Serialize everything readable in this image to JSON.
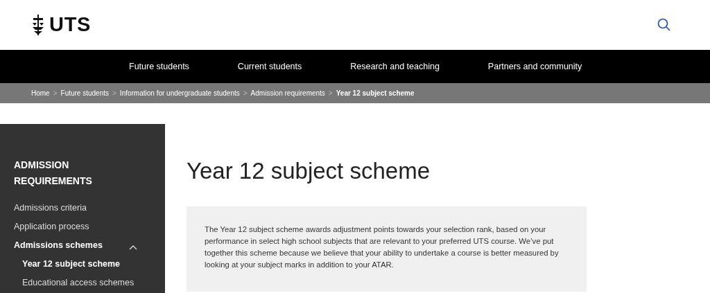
{
  "header": {
    "logo_text": "UTS"
  },
  "nav": [
    {
      "label": "Future students"
    },
    {
      "label": "Current students"
    },
    {
      "label": "Research and teaching"
    },
    {
      "label": "Partners and community"
    }
  ],
  "breadcrumb": [
    {
      "label": "Home",
      "current": false
    },
    {
      "label": "Future students",
      "current": false
    },
    {
      "label": "Information for undergraduate students",
      "current": false
    },
    {
      "label": "Admission requirements",
      "current": false
    },
    {
      "label": "Year 12 subject scheme",
      "current": true
    }
  ],
  "breadcrumb_separator": ">",
  "sidebar": {
    "title": "ADMISSION REQUIREMENTS",
    "items": [
      {
        "label": "Admissions criteria",
        "selected": false
      },
      {
        "label": "Application process",
        "selected": false
      },
      {
        "label": "Admissions schemes",
        "selected": true,
        "expanded": true,
        "children": [
          {
            "label": "Year 12 subject scheme",
            "selected": true
          },
          {
            "label": "Educational access schemes",
            "selected": false
          }
        ]
      }
    ]
  },
  "main": {
    "title": "Year 12 subject scheme",
    "intro": "The Year 12 subject scheme awards adjustment points towards your selection rank, based on your performance in select high school subjects that are relevant to your preferred UTS course. We’ve put together this scheme because we believe that your ability to undertake a course is better measured by looking at your subject marks in addition to your ATAR."
  }
}
